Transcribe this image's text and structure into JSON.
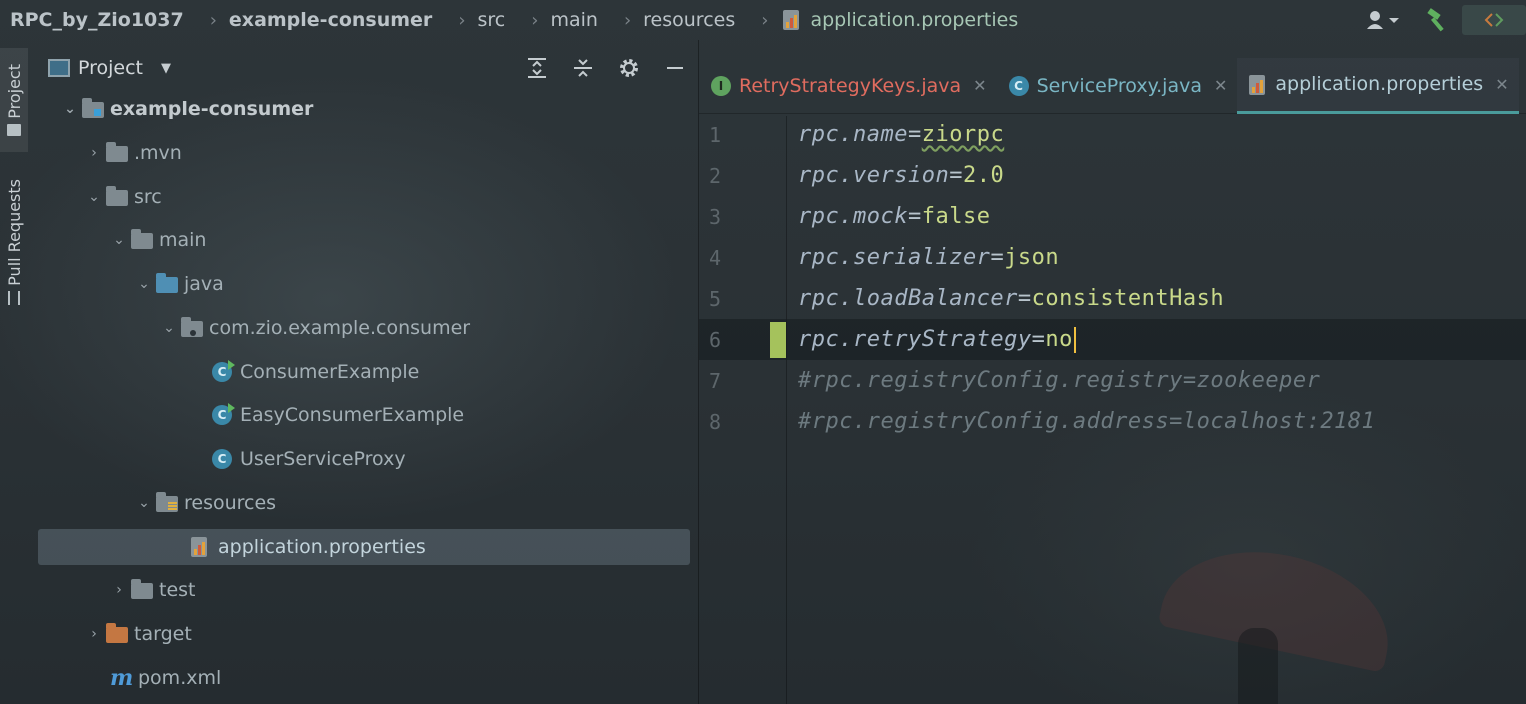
{
  "breadcrumb": {
    "project": "RPC_by_Zio1037",
    "module": "example-consumer",
    "src": "src",
    "main": "main",
    "resources": "resources",
    "file": "application.properties"
  },
  "tool_strip": {
    "project_tab": "Project",
    "pull_requests_tab": "Pull Requests"
  },
  "project_panel": {
    "title": "Project",
    "tree": [
      {
        "label": "example-consumer",
        "kind": "module"
      },
      {
        "label": ".mvn",
        "kind": "folder"
      },
      {
        "label": "src",
        "kind": "folder"
      },
      {
        "label": "main",
        "kind": "folder"
      },
      {
        "label": "java",
        "kind": "source-folder"
      },
      {
        "label": "com.zio.example.consumer",
        "kind": "package"
      },
      {
        "label": "ConsumerExample",
        "kind": "class-runnable"
      },
      {
        "label": "EasyConsumerExample",
        "kind": "class-runnable"
      },
      {
        "label": "UserServiceProxy",
        "kind": "class"
      },
      {
        "label": "resources",
        "kind": "resources-folder"
      },
      {
        "label": "application.properties",
        "kind": "properties",
        "selected": true
      },
      {
        "label": "test",
        "kind": "folder"
      },
      {
        "label": "target",
        "kind": "excluded-folder"
      },
      {
        "label": "pom.xml",
        "kind": "maven"
      }
    ]
  },
  "editor": {
    "tabs": [
      {
        "label": "RetryStrategyKeys.java",
        "icon": "I"
      },
      {
        "label": "ServiceProxy.java",
        "icon": "C"
      },
      {
        "label": "application.properties",
        "active": true
      }
    ],
    "lines": [
      {
        "n": "1",
        "key": "rpc.name",
        "value": "ziorpc"
      },
      {
        "n": "2",
        "key": "rpc.version",
        "value": "2.0"
      },
      {
        "n": "3",
        "key": "rpc.mock",
        "value": "false"
      },
      {
        "n": "4",
        "key": "rpc.serializer",
        "value": "json"
      },
      {
        "n": "5",
        "key": "rpc.loadBalancer",
        "value": "consistentHash"
      },
      {
        "n": "6",
        "key": "rpc.retryStrategy",
        "value": "no"
      },
      {
        "n": "7",
        "comment": "#rpc.registryConfig.registry=zookeeper"
      },
      {
        "n": "8",
        "comment": "#rpc.registryConfig.address=localhost:2181"
      }
    ],
    "equals": "="
  },
  "colors": {
    "accent_teal": "#4a9b9b",
    "value_green": "#c9d98a",
    "change_marker": "#a5c25c",
    "caret": "#f0c040"
  }
}
